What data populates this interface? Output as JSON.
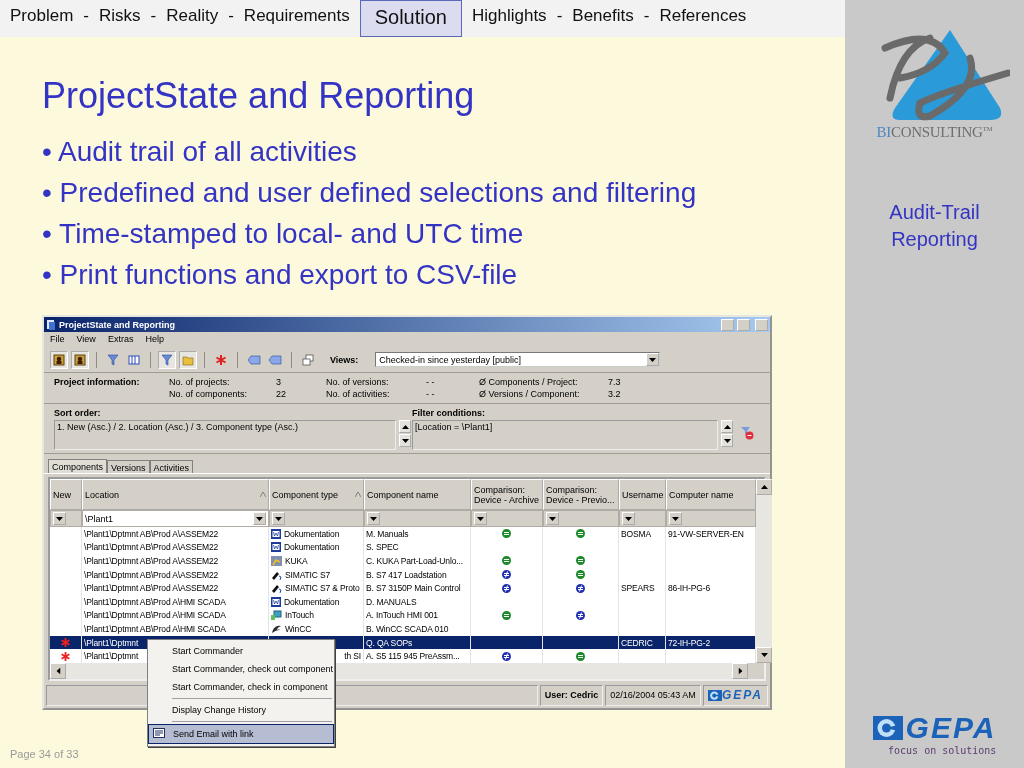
{
  "nav": [
    {
      "kind": "link",
      "label": "Problem",
      "selected": false
    },
    {
      "kind": "separator",
      "label": "-",
      "selected": false
    },
    {
      "kind": "link",
      "label": "Risks",
      "selected": false
    },
    {
      "kind": "separator",
      "label": "-",
      "selected": false
    },
    {
      "kind": "link",
      "label": "Reality",
      "selected": false
    },
    {
      "kind": "separator",
      "label": "-",
      "selected": false
    },
    {
      "kind": "link",
      "label": "Requirements",
      "selected": false
    },
    {
      "kind": "link",
      "label": "Solution",
      "selected": true
    },
    {
      "kind": "link",
      "label": "Highlights",
      "selected": false
    },
    {
      "kind": "separator",
      "label": "-",
      "selected": false
    },
    {
      "kind": "link",
      "label": "Benefits",
      "selected": false
    },
    {
      "kind": "separator",
      "label": "-",
      "selected": false
    },
    {
      "kind": "link",
      "label": "References",
      "selected": false
    }
  ],
  "slide": {
    "title": "ProjectState and Reporting",
    "bullet": "•",
    "bullets": [
      "Audit trail of all activities",
      "Predefined and user defined selections and filtering",
      "Time-stamped to local- and UTC time",
      "Print functions and export to CSV-file"
    ],
    "page": "Page 34 of 33"
  },
  "sidebar": {
    "brand_lead": "BI",
    "brand_rest": "CONSULTING",
    "brand_mark": "TM",
    "caption": [
      "Audit-Trail",
      "Reporting"
    ],
    "footer_brand": "GEPA",
    "footer_tagline": "focus on solutions"
  },
  "window": {
    "title": "ProjectState and Reporting",
    "menu": [
      "File",
      "View",
      "Extras",
      "Help"
    ],
    "toolbar": [
      {
        "kind": "person",
        "pressed": true
      },
      {
        "kind": "person",
        "pressed": true
      },
      {
        "kind": "separator"
      },
      {
        "kind": "funnel",
        "pressed": false
      },
      {
        "kind": "columns",
        "pressed": false
      },
      {
        "kind": "separator"
      },
      {
        "kind": "funnel",
        "pressed": true
      },
      {
        "kind": "folder",
        "pressed": true
      },
      {
        "kind": "separator"
      },
      {
        "kind": "asterisk",
        "pressed": false
      },
      {
        "kind": "separator"
      },
      {
        "kind": "tag",
        "pressed": false
      },
      {
        "kind": "tag",
        "pressed": false
      },
      {
        "kind": "separator"
      },
      {
        "kind": "windows",
        "pressed": false
      }
    ],
    "views": {
      "label": "Views:",
      "value": "Checked-in since yesterday [public]"
    },
    "project_info": {
      "label": "Project information:",
      "stats": [
        {
          "label": "No. of projects:",
          "value": "3"
        },
        {
          "label": "No. of components:",
          "value": "22"
        },
        {
          "label": "No. of versions:",
          "value": "- -"
        },
        {
          "label": "No. of activities:",
          "value": "- -"
        },
        {
          "label": "Ø Components / Project:",
          "value": "7.3"
        },
        {
          "label": "Ø Versions / Component:",
          "value": "3.2"
        }
      ]
    },
    "sort": {
      "label": "Sort order:",
      "value": "1. New (Asc.) / 2. Location (Asc.) / 3. Component type (Asc.)"
    },
    "filter": {
      "label": "Filter conditions:",
      "value": "[Location = \\Plant1]"
    },
    "tabs": [
      {
        "label": "Components",
        "selected": true
      },
      {
        "label": "Versions",
        "selected": false
      },
      {
        "label": "Activities",
        "selected": false
      }
    ],
    "table": {
      "columns": [
        {
          "label": "New",
          "sorted": false
        },
        {
          "label": "Location",
          "sorted": true,
          "filter": "\\Plant1"
        },
        {
          "label": "Component type",
          "sorted": true
        },
        {
          "label": "Component name",
          "sorted": false
        },
        {
          "label": "Comparison: Device - Archive",
          "sorted": false
        },
        {
          "label": "Comparison: Device - Previo...",
          "sorted": false
        },
        {
          "label": "Username",
          "sorted": false
        },
        {
          "label": "Computer name",
          "sorted": false
        }
      ],
      "rows": [
        {
          "new": false,
          "selected": false,
          "location": "\\Plant1\\Dptmnt AB\\Prod A\\ASSEM22",
          "type": {
            "kind": "document",
            "label": "Dokumentation"
          },
          "name": "M. Manuals",
          "archive": {
            "kind": "equal"
          },
          "previous": {
            "kind": "equal"
          },
          "username": "BOSMA",
          "computer": "91-VW-SERVER-EN"
        },
        {
          "new": false,
          "selected": false,
          "location": "\\Plant1\\Dptmnt AB\\Prod A\\ASSEM22",
          "type": {
            "kind": "document",
            "label": "Dokumentation"
          },
          "name": "S. SPEC"
        },
        {
          "new": false,
          "selected": false,
          "location": "\\Plant1\\Dptmnt AB\\Prod A\\ASSEM22",
          "type": {
            "kind": "robot",
            "label": "KUKA"
          },
          "name": "C. KUKA Part-Load-Unlo...",
          "archive": {
            "kind": "equal"
          },
          "previous": {
            "kind": "equal"
          }
        },
        {
          "new": false,
          "selected": false,
          "location": "\\Plant1\\Dptmnt AB\\Prod A\\ASSEM22",
          "type": {
            "kind": "plug",
            "label": "SIMATIC S7"
          },
          "name": "B. S7 417 Loadstation",
          "archive": {
            "kind": "unequal"
          },
          "previous": {
            "kind": "equal"
          }
        },
        {
          "new": false,
          "selected": false,
          "location": "\\Plant1\\Dptmnt AB\\Prod A\\ASSEM22",
          "type": {
            "kind": "plug",
            "label": "SIMATIC S7 & Proto"
          },
          "name": "B. S7 3150P Main Control",
          "archive": {
            "kind": "unequal"
          },
          "previous": {
            "kind": "unequal"
          },
          "username": "SPEARS",
          "computer": "86-IH-PG-6"
        },
        {
          "new": false,
          "selected": false,
          "location": "\\Plant1\\Dptmnt AB\\Prod A\\HMI SCADA",
          "type": {
            "kind": "document",
            "label": "Dokumentation"
          },
          "name": "D. MANUALS"
        },
        {
          "new": false,
          "selected": false,
          "location": "\\Plant1\\Dptmnt AB\\Prod A\\HMI SCADA",
          "type": {
            "kind": "screen",
            "label": "InTouch"
          },
          "name": "A. InTouch HMI 001",
          "archive": {
            "kind": "equal"
          },
          "previous": {
            "kind": "unequal"
          }
        },
        {
          "new": false,
          "selected": false,
          "location": "\\Plant1\\Dptmnt AB\\Prod A\\HMI SCADA",
          "type": {
            "kind": "bird",
            "label": "WinCC"
          },
          "name": "B. WinCC SCADA 010"
        },
        {
          "new": true,
          "selected": true,
          "location": "\\Plant1\\Dptmnt",
          "name": "Q. QA SOPs",
          "username": "CEDRIC",
          "computer": "72-IH-PG-2"
        },
        {
          "new": true,
          "selected": false,
          "location": "\\Plant1\\Dptmnt",
          "type": {
            "kind": "text",
            "label": "th SI"
          },
          "name": "A. S5 115 945 PreAssm...",
          "archive": {
            "kind": "unequal"
          },
          "previous": {
            "kind": "equal"
          }
        }
      ]
    },
    "status_bar": {
      "user": "User: Cedric",
      "datetime": "02/16/2004 05:43 AM",
      "logo": "GEPA"
    },
    "context_menu": [
      {
        "kind": "item",
        "label": "Start Commander",
        "selected": false
      },
      {
        "kind": "item",
        "label": "Start Commander, check out component",
        "selected": false
      },
      {
        "kind": "item",
        "label": "Start Commander, check in component",
        "selected": false
      },
      {
        "kind": "separator"
      },
      {
        "kind": "item",
        "label": "Display Change History",
        "selected": false
      },
      {
        "kind": "separator"
      },
      {
        "kind": "email",
        "label": "Send Email with link",
        "selected": true
      }
    ]
  }
}
